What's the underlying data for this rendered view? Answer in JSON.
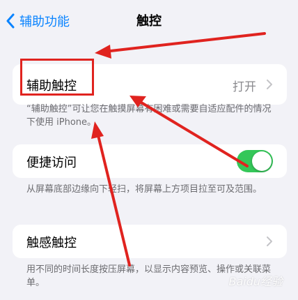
{
  "nav": {
    "back_label": "辅助功能",
    "title": "触控"
  },
  "settings": {
    "assistive_touch": {
      "label": "辅助触控",
      "value": "打开",
      "note": "“辅助触控”可让您在触摸屏幕有困难或需要自适应配件的情况下使用 iPhone。"
    },
    "back_tap": {
      "label": "便捷访问",
      "toggle_on": true,
      "note": "从屏幕底部边缘向下轻扫，将屏幕上方项目拉至可及范围。"
    },
    "haptic_touch": {
      "label": "触感触控",
      "note": "用不同的时间长度按压屏幕，以显示内容预览、操作或关联菜单。"
    }
  },
  "watermark": "Baidu经验",
  "colors": {
    "accent": "#0a84ff",
    "toggle": "#34c759",
    "annotation": "#e0231f"
  }
}
